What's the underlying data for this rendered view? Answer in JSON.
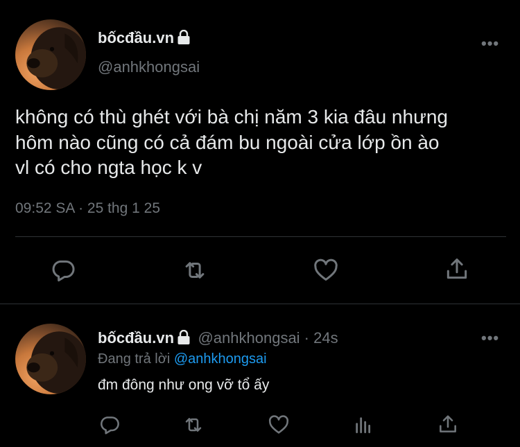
{
  "main_tweet": {
    "display_name": "bốcđầu.vn",
    "handle": "@anhkhongsai",
    "text_line1": "không có thù ghét với bà chị năm 3 kia đâu nhưng",
    "text_line2": "hôm nào cũng có cả đám bu ngoài cửa lớp ồn ào",
    "text_line3": "vl có cho ngta học k v",
    "timestamp": "09:52 SA · 25 thg 1 25",
    "more": "•••",
    "actions": [
      "reply-icon",
      "retweet-icon",
      "like-icon",
      "share-icon"
    ]
  },
  "reply_tweet": {
    "display_name": "bốcđầu.vn",
    "handle_time": "@anhkhongsai · 24s",
    "replying_prefix": "Đang trả lời ",
    "replying_mention": "@anhkhongsai",
    "text": "đm đông như ong vỡ tổ ấy",
    "more": "•••",
    "actions": [
      "reply-icon",
      "retweet-icon",
      "like-icon",
      "views-icon",
      "share-icon"
    ]
  },
  "colors": {
    "background": "#000000",
    "text": "#e7e9ea",
    "muted": "#71767b",
    "accent": "#1d9bf0",
    "divider": "#2f3336"
  }
}
